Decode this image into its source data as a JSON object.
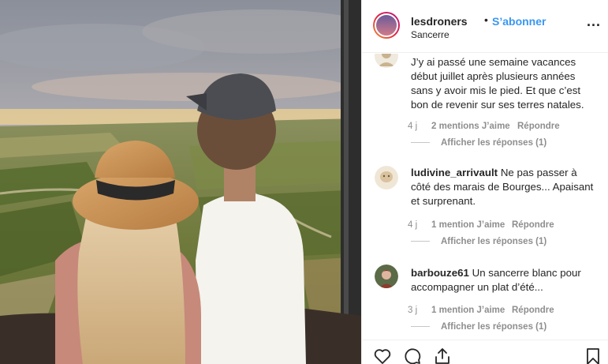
{
  "header": {
    "username": "lesdroners",
    "separator": "•",
    "follow_label": "S’abonner",
    "location": "Sancerre",
    "more_label": "..."
  },
  "comments": [
    {
      "author": "",
      "text": "J’y ai passé une semaine vacances début juillet après plusieurs années sans y avoir mis le pied. Et que c’est bon de revenir sur ses terres natales.",
      "time": "4 j",
      "likes": "2 mentions J’aime",
      "reply_label": "Répondre",
      "view_replies": "Afficher les réponses (1)"
    },
    {
      "author": "ludivine_arrivault",
      "text": "Ne pas passer à côté des marais de Bourges... Apaisant et surprenant.",
      "time": "4 j",
      "likes": "1 mention J’aime",
      "reply_label": "Répondre",
      "view_replies": "Afficher les réponses (1)"
    },
    {
      "author": "barbouze61",
      "text": "Un sancerre blanc pour accompagner un plat d’été...",
      "time": "3 j",
      "likes": "1 mention J’aime",
      "reply_label": "Répondre",
      "view_replies": "Afficher les réponses (1)"
    }
  ],
  "actions": {
    "icons": [
      "heart-icon",
      "comment-icon",
      "share-icon",
      "bookmark-icon"
    ]
  },
  "colors": {
    "link": "#3897f0",
    "secondary_text": "#8e8e8e",
    "border": "#efefef"
  }
}
